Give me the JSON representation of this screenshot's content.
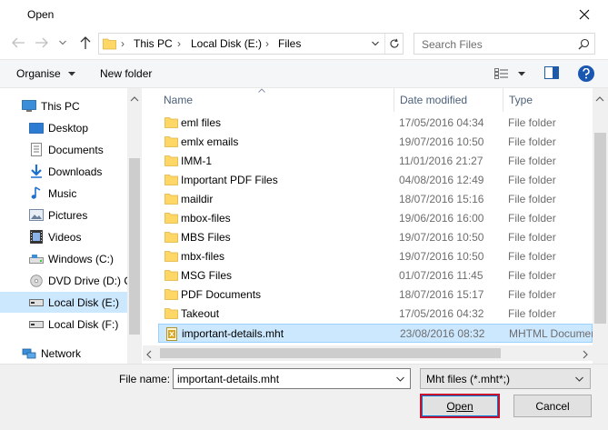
{
  "window": {
    "title": "Open"
  },
  "address": {
    "segments": [
      "This PC",
      "Local Disk (E:)",
      "Files"
    ]
  },
  "search": {
    "placeholder": "Search Files"
  },
  "toolbar": {
    "organise_label": "Organise",
    "new_folder_label": "New folder"
  },
  "nav": {
    "items": [
      {
        "label": "This PC",
        "icon": "computer-icon"
      },
      {
        "label": "Desktop",
        "icon": "desktop-icon"
      },
      {
        "label": "Documents",
        "icon": "documents-icon"
      },
      {
        "label": "Downloads",
        "icon": "download-icon"
      },
      {
        "label": "Music",
        "icon": "music-icon"
      },
      {
        "label": "Pictures",
        "icon": "pictures-icon"
      },
      {
        "label": "Videos",
        "icon": "videos-icon"
      },
      {
        "label": "Windows (C:)",
        "icon": "drive-icon"
      },
      {
        "label": "DVD Drive (D:) C",
        "icon": "dvd-icon"
      },
      {
        "label": "Local Disk (E:)",
        "icon": "drive-icon"
      },
      {
        "label": "Local Disk (F:)",
        "icon": "drive-icon"
      },
      {
        "label": "Network",
        "icon": "network-icon"
      }
    ]
  },
  "columns": {
    "name": "Name",
    "date": "Date modified",
    "type": "Type"
  },
  "files": [
    {
      "name": "eml files",
      "date": "17/05/2016 04:34",
      "type": "File folder"
    },
    {
      "name": "emlx emails",
      "date": "19/07/2016 10:50",
      "type": "File folder"
    },
    {
      "name": "IMM-1",
      "date": "11/01/2016 21:27",
      "type": "File folder"
    },
    {
      "name": "Important PDF Files",
      "date": "04/08/2016 12:49",
      "type": "File folder"
    },
    {
      "name": "maildir",
      "date": "18/07/2016 15:16",
      "type": "File folder"
    },
    {
      "name": "mbox-files",
      "date": "19/06/2016 16:00",
      "type": "File folder"
    },
    {
      "name": "MBS Files",
      "date": "19/07/2016 10:50",
      "type": "File folder"
    },
    {
      "name": "mbx-files",
      "date": "19/07/2016 10:50",
      "type": "File folder"
    },
    {
      "name": "MSG Files",
      "date": "01/07/2016 11:45",
      "type": "File folder"
    },
    {
      "name": "PDF Documents",
      "date": "18/07/2016 15:17",
      "type": "File folder"
    },
    {
      "name": "Takeout",
      "date": "17/05/2016 04:32",
      "type": "File folder"
    },
    {
      "name": "important-details.mht",
      "date": "23/08/2016 08:32",
      "type": "MHTML Document"
    }
  ],
  "bottom": {
    "file_name_label": "File name:",
    "file_name_value": "important-details.mht",
    "filter_value": "Mht files (*.mht*;)",
    "open_label": "Open",
    "cancel_label": "Cancel"
  },
  "colors": {
    "selection": "#cce8ff",
    "folder": "#ffd766",
    "accent": "#0078d7",
    "open_border": "#c8102e"
  }
}
